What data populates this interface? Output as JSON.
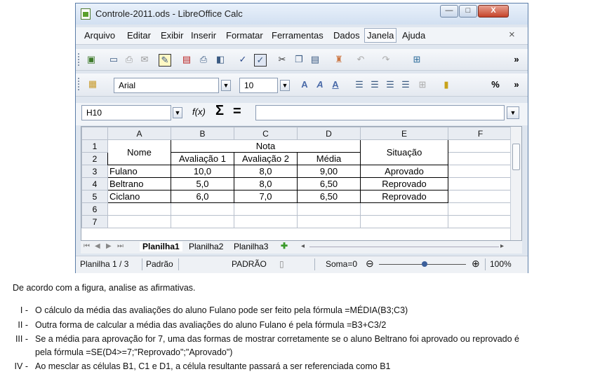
{
  "window": {
    "title": "Controle-2011.ods - LibreOffice Calc",
    "buttons": {
      "minimize": "—",
      "maximize": "□",
      "close": "X"
    }
  },
  "menu": [
    "Arquivo",
    "Editar",
    "Exibir",
    "Inserir",
    "Formatar",
    "Ferramentas",
    "Dados",
    "Janela",
    "Ajuda"
  ],
  "menu_close": "×",
  "format_toolbar": {
    "font": "Arial",
    "size": "10",
    "percent": "%",
    "more": "»"
  },
  "standard_toolbar": {
    "more": "»"
  },
  "formula_bar": {
    "name_box": "H10",
    "fx": "f(x)",
    "sum": "Σ",
    "equals": "=",
    "value": ""
  },
  "columns": [
    "A",
    "B",
    "C",
    "D",
    "E",
    "F"
  ],
  "rows": [
    "1",
    "2",
    "3",
    "4",
    "5",
    "6",
    "7"
  ],
  "cells": {
    "A1": "Nome",
    "B1": "Nota",
    "B2": "Avaliação 1",
    "C2": "Avaliação 2",
    "D2": "Média",
    "E1": "Situação",
    "data": [
      {
        "name": "Fulano",
        "a1": "10,0",
        "a2": "8,0",
        "media": "9,00",
        "situacao": "Aprovado"
      },
      {
        "name": "Beltrano",
        "a1": "5,0",
        "a2": "8,0",
        "media": "6,50",
        "situacao": "Reprovado"
      },
      {
        "name": "Ciclano",
        "a1": "6,0",
        "a2": "7,0",
        "media": "6,50",
        "situacao": "Reprovado"
      }
    ]
  },
  "sheet_tabs": [
    "Planilha1",
    "Planilha2",
    "Planilha3"
  ],
  "status": {
    "sheet": "Planilha 1 / 3",
    "style": "Padrão",
    "mode": "PADRÃO",
    "sum": "Soma=0",
    "zoom": "100%"
  },
  "question": {
    "intro": "De acordo com a figura, analise as afirmativas.",
    "items": [
      {
        "num": "I -",
        "text": "O cálculo da média das avaliações do aluno Fulano pode ser feito pela fórmula =MÉDIA(B3;C3)"
      },
      {
        "num": "II -",
        "text": "Outra forma de calcular a média das avaliações do aluno Fulano é pela fórmula =B3+C3/2"
      },
      {
        "num": "III -",
        "text": "Se a média para aprovação for 7, uma das formas de mostrar corretamente se o aluno Beltrano foi aprovado ou reprovado é",
        "text2": "pela fórmula =SE(D4>=7;\"Reprovado\";\"Aprovado\")"
      },
      {
        "num": "IV -",
        "text": "Ao mesclar as células B1, C1 e D1, a célula resultante passará a ser referenciada como B1"
      }
    ]
  }
}
